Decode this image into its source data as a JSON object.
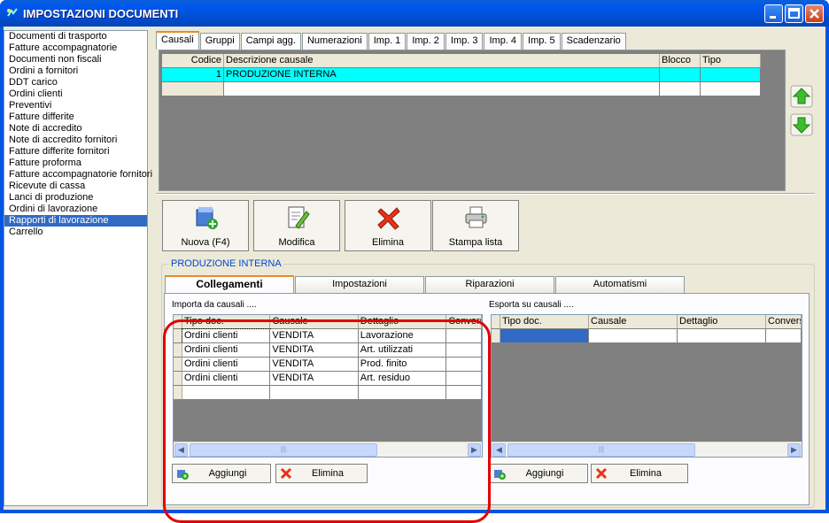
{
  "window": {
    "title": "IMPOSTAZIONI DOCUMENTI"
  },
  "doc_list": {
    "items": [
      "Documenti di trasporto",
      "Fatture accompagnatorie",
      "Documenti non fiscali",
      "Ordini a fornitori",
      "DDT carico",
      "Ordini clienti",
      "Preventivi",
      "Fatture differite",
      "Note di accredito",
      "Note di accredito fornitori",
      "Fatture differite fornitori",
      "Fatture proforma",
      "Fatture accompagnatorie fornitori",
      "Ricevute di cassa",
      "Lanci di produzione",
      "Ordini di lavorazione",
      "Rapporti di lavorazione",
      "Carrello"
    ],
    "selected": "Rapporti di lavorazione"
  },
  "top_tabs": [
    "Causali",
    "Gruppi",
    "Campi agg.",
    "Numerazioni",
    "Imp. 1",
    "Imp. 2",
    "Imp. 3",
    "Imp. 4",
    "Imp. 5",
    "Scadenzario"
  ],
  "causali_grid": {
    "headers": [
      "Codice",
      "Descrizione causale",
      "Blocco",
      "Tipo"
    ],
    "rows": [
      {
        "codice": "1",
        "descrizione": "PRODUZIONE INTERNA",
        "blocco": "",
        "tipo": ""
      }
    ]
  },
  "toolbar": {
    "nuova": "Nuova (F4)",
    "modifica": "Modifica",
    "elimina": "Elimina",
    "stampa": "Stampa lista"
  },
  "group_title": "PRODUZIONE INTERNA",
  "lower_tabs": [
    "Collegamenti",
    "Impostazioni",
    "Riparazioni",
    "Automatismi"
  ],
  "importa": {
    "label": "Importa da causali ....",
    "headers": [
      "Tipo doc.",
      "Causale",
      "Dettaglio",
      "Convers"
    ],
    "rows": [
      [
        "Ordini clienti",
        "VENDITA",
        "Lavorazione",
        ""
      ],
      [
        "Ordini clienti",
        "VENDITA",
        "Art. utilizzati",
        ""
      ],
      [
        "Ordini clienti",
        "VENDITA",
        "Prod. finito",
        ""
      ],
      [
        "Ordini clienti",
        "VENDITA",
        "Art. residuo",
        ""
      ]
    ],
    "add": "Aggiungi",
    "del": "Elimina"
  },
  "esporta": {
    "label": "Esporta su causali ....",
    "headers": [
      "Tipo doc.",
      "Causale",
      "Dettaglio",
      "Conversi"
    ],
    "add": "Aggiungi",
    "del": "Elimina"
  },
  "colors": {
    "title_blue": "#0054e3",
    "selection_cyan": "#00ffff",
    "highlight_red": "#e20000",
    "list_select": "#316ac5"
  }
}
